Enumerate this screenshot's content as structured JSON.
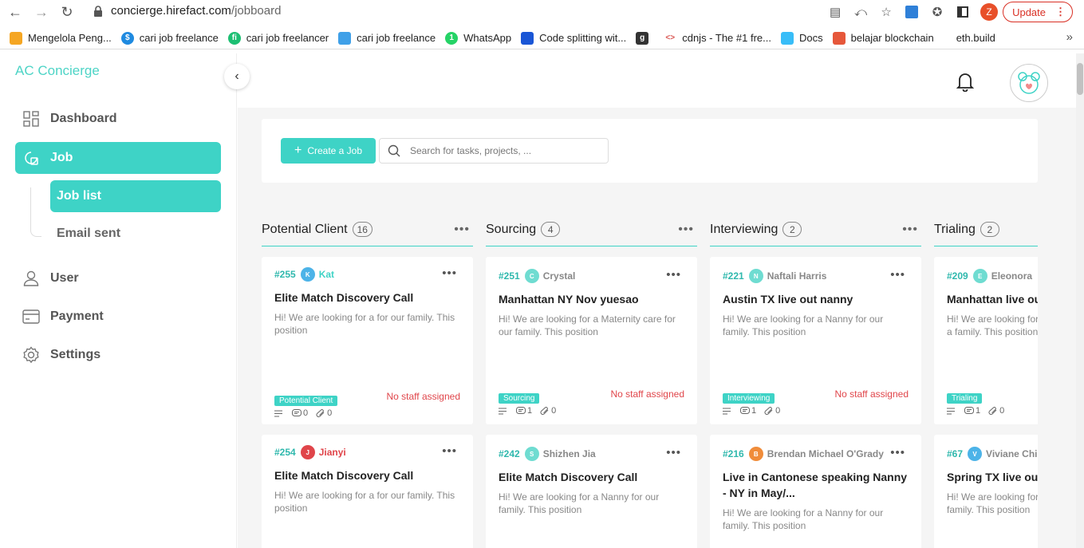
{
  "browser": {
    "url_host": "concierge.hirefact.com",
    "url_path": "/jobboard",
    "profile_initial": "Z",
    "update_label": "Update",
    "bookmarks": [
      "Mengelola Peng...",
      "cari job freelance",
      "cari job freelancer",
      "cari job freelance",
      "WhatsApp",
      "Code splitting wit...",
      "cdnjs - The #1 fre...",
      "Docs",
      "belajar blockchain",
      "eth.build"
    ]
  },
  "sidebar": {
    "brand": "AC Concierge",
    "items": {
      "dashboard": "Dashboard",
      "job": "Job",
      "job_list": "Job list",
      "email_sent": "Email sent",
      "user": "User",
      "payment": "Payment",
      "settings": "Settings"
    }
  },
  "toolbar": {
    "create_label": "Create a Job",
    "search_placeholder": "Search for tasks, projects, ..."
  },
  "colors": {
    "accent": "#3ed3c6",
    "danger": "#e0454a"
  },
  "columns": [
    {
      "title": "Potential Client",
      "count": "16",
      "cards": [
        {
          "id": "#255",
          "initial": "K",
          "owner": "Kat",
          "title": "Elite Match Discovery Call",
          "desc": "Hi! We are looking for a for our family. This position",
          "tag": "Potential Client",
          "staff": "No staff assigned",
          "desc_count": "",
          "comments": "0",
          "attachments": "0"
        },
        {
          "id": "#254",
          "initial": "J",
          "owner": "Jianyi",
          "title": "Elite Match Discovery Call",
          "desc": "Hi! We are looking for a for our family. This position"
        }
      ]
    },
    {
      "title": "Sourcing",
      "count": "4",
      "cards": [
        {
          "id": "#251",
          "initial": "C",
          "owner": "Crystal",
          "title": "Manhattan NY Nov yuesao",
          "desc": "Hi! We are looking for a Maternity care for our family. This position",
          "tag": "Sourcing",
          "staff": "No staff assigned",
          "comments": "1",
          "attachments": "0"
        },
        {
          "id": "#242",
          "initial": "S",
          "owner": "Shizhen Jia",
          "title": "Elite Match Discovery Call",
          "desc": "Hi! We are looking for a Nanny for our family. This position"
        }
      ]
    },
    {
      "title": "Interviewing",
      "count": "2",
      "cards": [
        {
          "id": "#221",
          "initial": "N",
          "owner": "Naftali Harris",
          "title": "Austin TX live out nanny",
          "desc": "Hi! We are looking for a Nanny for our family. This position",
          "tag": "Interviewing",
          "staff": "No staff assigned",
          "comments": "1",
          "attachments": "0"
        },
        {
          "id": "#216",
          "initial": "B",
          "owner": "Brendan Michael O'Grady",
          "title": "Live in Cantonese speaking Nanny - NY in May/...",
          "desc": "Hi! We are looking for a Nanny for our family. This position"
        }
      ]
    },
    {
      "title": "Trialing",
      "count": "2",
      "cards": [
        {
          "id": "#209",
          "initial": "E",
          "owner": "Eleonora",
          "title": "Manhattan live out",
          "desc": "Hi! We are looking for a family. This position",
          "tag": "Trialing",
          "comments": "1",
          "attachments": "0"
        },
        {
          "id": "#67",
          "initial": "V",
          "owner": "Viviane Chi",
          "title": "Spring TX live out",
          "desc": "Hi! We are looking for family. This position"
        }
      ]
    }
  ]
}
